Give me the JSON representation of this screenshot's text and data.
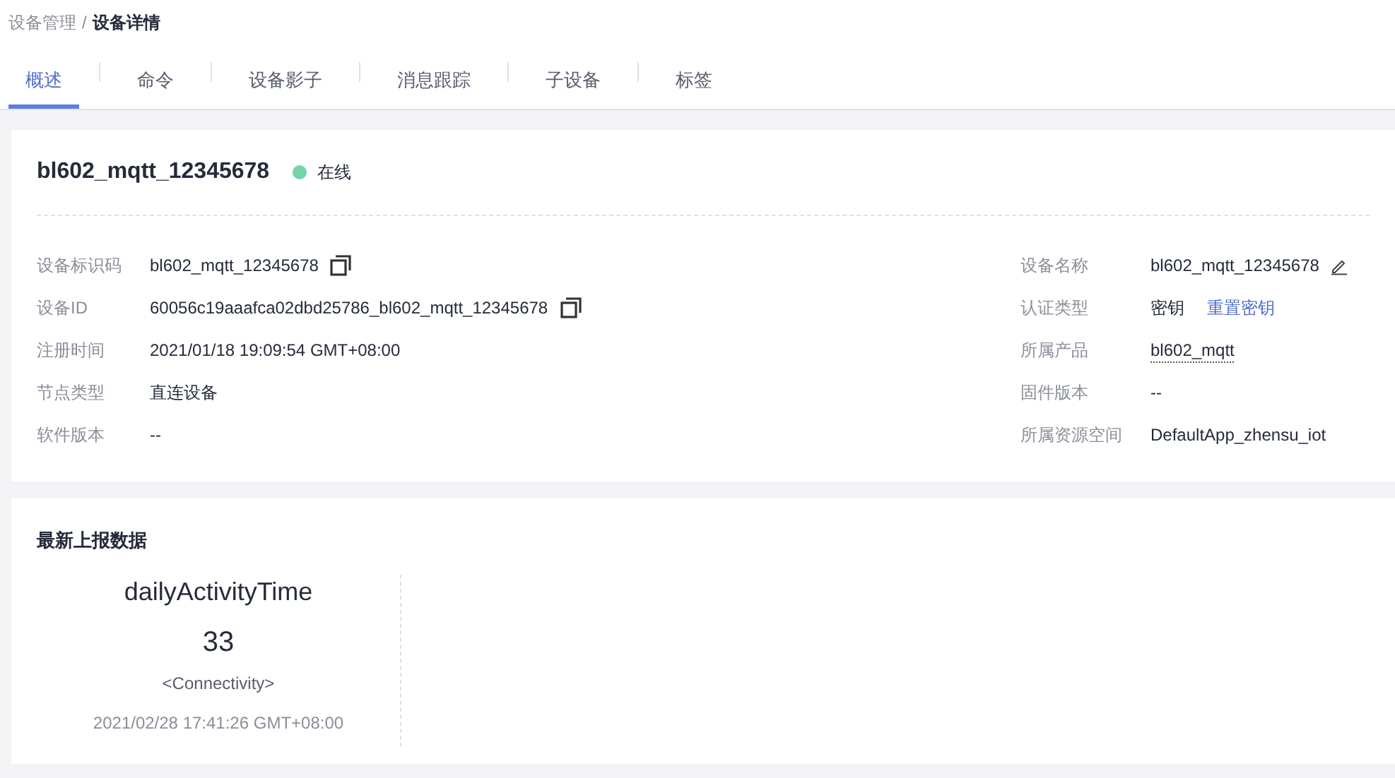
{
  "breadcrumb": [
    {
      "label": "设备管理",
      "current": false
    },
    {
      "label": "设备详情",
      "current": true
    }
  ],
  "breadcrumb_separator": "/",
  "tabs": [
    {
      "label": "概述",
      "selected": true
    },
    {
      "label": "命令",
      "selected": false
    },
    {
      "label": "设备影子",
      "selected": false
    },
    {
      "label": "消息跟踪",
      "selected": false
    },
    {
      "label": "子设备",
      "selected": false
    },
    {
      "label": "标签",
      "selected": false
    }
  ],
  "device": {
    "name": "bl602_mqtt_12345678",
    "status": {
      "label": "在线",
      "color": "#72d5a9"
    }
  },
  "fields_left": [
    {
      "label": "设备标识码",
      "value": "bl602_mqtt_12345678",
      "kind": "copy"
    },
    {
      "label": "设备ID",
      "value": "60056c19aaafca02dbd25786_bl602_mqtt_12345678",
      "kind": "copy"
    },
    {
      "label": "注册时间",
      "value": "2021/01/18 19:09:54 GMT+08:00",
      "kind": "plain"
    },
    {
      "label": "节点类型",
      "value": "直连设备",
      "kind": "plain"
    },
    {
      "label": "软件版本",
      "value": "--",
      "kind": "plain"
    }
  ],
  "fields_right": [
    {
      "label": "设备名称",
      "value": "bl602_mqtt_12345678",
      "kind": "edit"
    },
    {
      "label": "认证类型",
      "value": "密钥",
      "kind": "action",
      "action": "重置密钥"
    },
    {
      "label": "所属产品",
      "value": "bl602_mqtt",
      "kind": "link"
    },
    {
      "label": "固件版本",
      "value": "--",
      "kind": "plain"
    },
    {
      "label": "所属资源空间",
      "value": "DefaultApp_zhensu_iot",
      "kind": "plain"
    }
  ],
  "latest_data": {
    "title": "最新上报数据",
    "items": [
      {
        "name": "dailyActivityTime",
        "value": "33",
        "service": "<Connectivity>",
        "time": "2021/02/28 17:41:26 GMT+08:00"
      }
    ]
  }
}
